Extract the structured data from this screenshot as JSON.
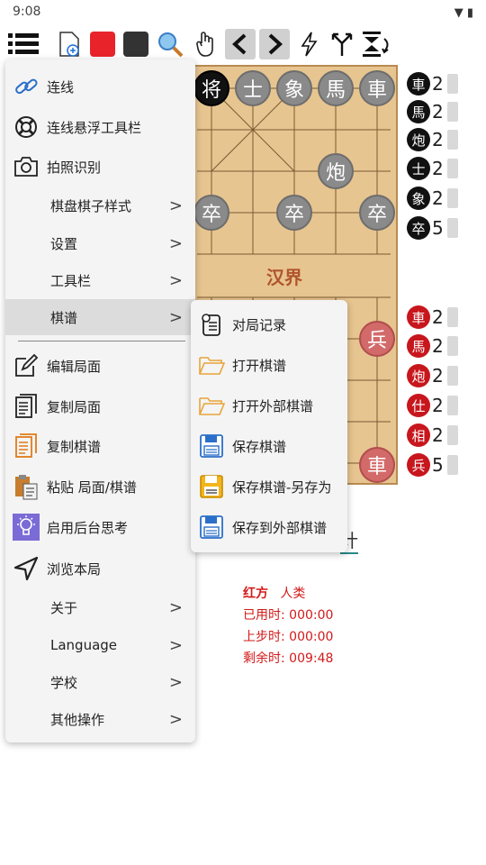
{
  "status": {
    "time": "9:08",
    "icons": "▼ ▮"
  },
  "board": {
    "river_label": "汉界",
    "pieces": [
      {
        "ch": "将",
        "kind": "king"
      },
      {
        "ch": "士",
        "kind": "black"
      },
      {
        "ch": "象",
        "kind": "black"
      },
      {
        "ch": "馬",
        "kind": "black"
      },
      {
        "ch": "車",
        "kind": "black"
      },
      {
        "ch": "炮",
        "kind": "black"
      },
      {
        "ch": "卒",
        "kind": "black"
      },
      {
        "ch": "卒",
        "kind": "black"
      },
      {
        "ch": "卒",
        "kind": "black"
      },
      {
        "ch": "兵",
        "kind": "red"
      },
      {
        "ch": "車",
        "kind": "red"
      }
    ]
  },
  "captures": {
    "black": [
      {
        "ch": "車",
        "count": "2"
      },
      {
        "ch": "馬",
        "count": "2"
      },
      {
        "ch": "炮",
        "count": "2"
      },
      {
        "ch": "士",
        "count": "2"
      },
      {
        "ch": "象",
        "count": "2"
      },
      {
        "ch": "卒",
        "count": "5"
      }
    ],
    "red": [
      {
        "ch": "車",
        "count": "2"
      },
      {
        "ch": "馬",
        "count": "2"
      },
      {
        "ch": "炮",
        "count": "2"
      },
      {
        "ch": "仕",
        "count": "2"
      },
      {
        "ch": "相",
        "count": "2"
      },
      {
        "ch": "兵",
        "count": "5"
      }
    ]
  },
  "info": {
    "side": "红方",
    "player": "人类",
    "used_label": "已用时:",
    "used": "000:00",
    "last_label": "上步时:",
    "last": "000:00",
    "remain_label": "剩余时:",
    "remain": "009:48",
    "partial_text": "计"
  },
  "menu": {
    "items": [
      {
        "label": "连线",
        "icon": "link-icon"
      },
      {
        "label": "连线悬浮工具栏",
        "icon": "lifebuoy-icon"
      },
      {
        "label": "拍照识别",
        "icon": "camera-icon"
      },
      {
        "label": "棋盘棋子样式",
        "submenu": true
      },
      {
        "label": "设置",
        "submenu": true
      },
      {
        "label": "工具栏",
        "submenu": true
      },
      {
        "label": "棋谱",
        "submenu": true
      },
      {
        "label": "编辑局面",
        "icon": "edit-icon"
      },
      {
        "label": "复制局面",
        "icon": "copy-icon"
      },
      {
        "label": "复制棋谱",
        "icon": "copy-record-icon"
      },
      {
        "label": "粘贴 局面/棋谱",
        "icon": "paste-icon"
      },
      {
        "label": "启用后台思考",
        "icon": "bulb-icon"
      },
      {
        "label": "浏览本局",
        "icon": "navigate-icon"
      },
      {
        "label": "关于",
        "submenu": true
      },
      {
        "label": "Language",
        "submenu": true
      },
      {
        "label": "学校",
        "submenu": true
      },
      {
        "label": "其他操作",
        "submenu": true
      }
    ]
  },
  "submenu": {
    "items": [
      {
        "label": "对局记录",
        "icon": "record-icon"
      },
      {
        "label": "打开棋谱",
        "icon": "folder-icon"
      },
      {
        "label": "打开外部棋谱",
        "icon": "folder-icon"
      },
      {
        "label": "保存棋谱",
        "icon": "save-icon"
      },
      {
        "label": "保存棋谱-另存为",
        "icon": "save-as-icon"
      },
      {
        "label": "保存到外部棋谱",
        "icon": "save-external-icon"
      }
    ]
  },
  "colors": {
    "red_text": "#d21a1a",
    "board": "#e7c590",
    "menu_bg": "#f4f4f4",
    "highlight": "#dcdcdc"
  }
}
